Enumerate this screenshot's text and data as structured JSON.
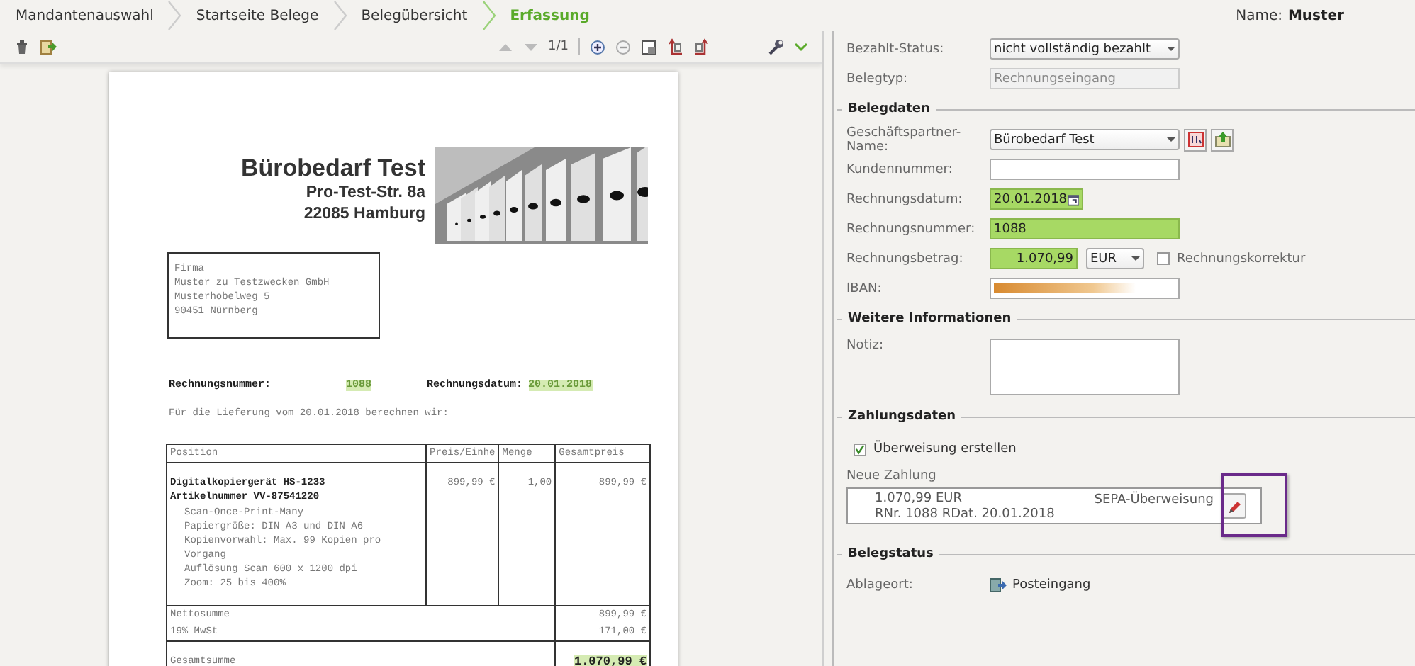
{
  "breadcrumbs": [
    {
      "label": "Mandantenauswahl",
      "selected": false
    },
    {
      "label": "Startseite Belege",
      "selected": false
    },
    {
      "label": "Belegübersicht",
      "selected": false
    },
    {
      "label": "Erfassung",
      "selected": true
    }
  ],
  "user": {
    "label": "Name:",
    "value": "Muster"
  },
  "viewer_toolbar": {
    "page": "1/1"
  },
  "document": {
    "sender": {
      "name": "Bürobedarf Test",
      "street": "Pro-Test-Str. 8a",
      "city": "22085 Hamburg"
    },
    "recipient": [
      "Firma",
      "Muster zu Testzwecken GmbH",
      "Musterhobelweg 5",
      "90451 Nürnberg"
    ],
    "invoice_number": {
      "label": "Rechnungsnummer:",
      "value": "1088",
      "highlighted": true
    },
    "invoice_date": {
      "label": "Rechnungsdatum:",
      "value": "20.01.2018",
      "highlighted": true
    },
    "intro": "Für die Lieferung vom 20.01.2018 berechnen wir:",
    "table": {
      "columns": [
        "Position",
        "Preis/Einhe",
        "Menge",
        "Gesamtpreis"
      ],
      "item": {
        "title": [
          "Digitalkopiergerät HS-1233",
          "Artikelnummer VV-87541220"
        ],
        "details": [
          "Scan-Once-Print-Many",
          "Papiergröße: DIN A3 und DIN A6",
          "Kopienvorwahl: Max. 99 Kopien pro Vorgang",
          "Auflösung Scan 600 x 1200 dpi",
          "Zoom: 25 bis 400%"
        ],
        "price": "899,99 €",
        "quantity": "1,00",
        "total": "899,99 €"
      },
      "summary": [
        {
          "label": "Nettosumme",
          "value": "899,99 €"
        },
        {
          "label": "19% MwSt",
          "value": "171,00 €"
        }
      ],
      "grand_total": {
        "label": "Gesamtsumme",
        "value": "1.070,99 €",
        "highlighted": true
      }
    }
  },
  "form": {
    "top_fields": [
      {
        "kind": "select",
        "label": "Bezahlt-Status:",
        "value": "nicht vollständig bezahlt"
      },
      {
        "kind": "readonly",
        "label": "Belegtyp:",
        "value": "Rechnungseingang"
      }
    ],
    "sections": [
      {
        "title": "Belegdaten",
        "fields": [
          {
            "kind": "partner",
            "label": "Geschäftspartner-Name:",
            "value": "Bürobedarf Test",
            "recognized": false
          },
          {
            "kind": "text",
            "label": "Kundennummer:",
            "recognized": false
          },
          {
            "kind": "date",
            "label": "Rechnungsdatum:",
            "value": "20.01.2018",
            "recognized": true
          },
          {
            "kind": "text",
            "label": "Rechnungsnummer:",
            "value": "1088",
            "recognized": true
          },
          {
            "kind": "amount",
            "label": "Rechnungsbetrag:",
            "value": "1.070,99",
            "recognized": true,
            "currency": "EUR",
            "correction": {
              "label": "Rechnungskorrektur",
              "checked": false
            }
          },
          {
            "kind": "iban",
            "label": "IBAN:"
          }
        ]
      },
      {
        "title": "Weitere Informationen",
        "fields": [
          {
            "kind": "textarea",
            "label": "Notiz:"
          }
        ]
      },
      {
        "title": "Zahlungsdaten",
        "fields": [
          {
            "kind": "checkbox",
            "label": "Überweisung erstellen",
            "checked": true
          },
          {
            "kind": "payment",
            "label": "Neue Zahlung",
            "amount": "1.070,99 EUR",
            "reference": "RNr. 1088 RDat. 20.01.2018",
            "method": "SEPA-Überweisung",
            "highlighted": true
          }
        ]
      },
      {
        "title": "Belegstatus",
        "fields": [
          {
            "kind": "location",
            "label": "Ablageort:",
            "value": "Posteingang"
          }
        ]
      }
    ]
  }
}
